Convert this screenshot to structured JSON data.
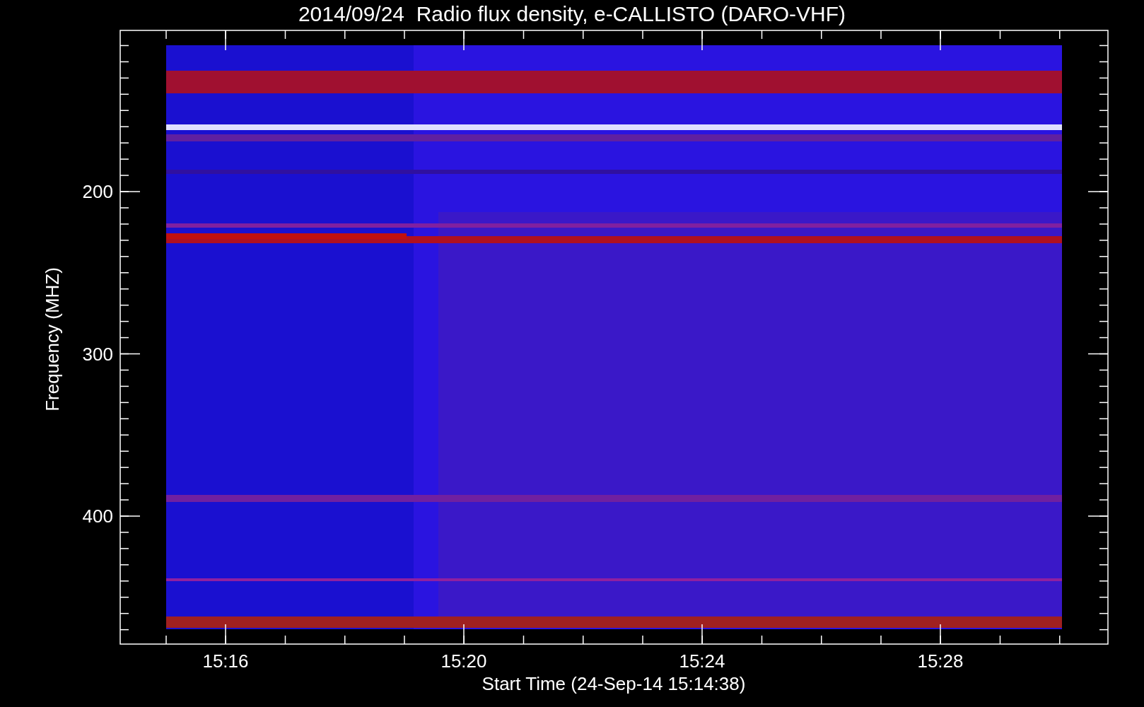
{
  "title": "2014/09/24  Radio flux density, e-CALLISTO (DARO-VHF)",
  "y_axis": {
    "label": "Frequency (MHZ)",
    "ticks": [
      "200",
      "300",
      "400"
    ]
  },
  "x_axis": {
    "label": "Start Time (24-Sep-14 15:14:38)",
    "ticks": [
      "15:16",
      "15:20",
      "15:24",
      "15:28"
    ]
  }
}
